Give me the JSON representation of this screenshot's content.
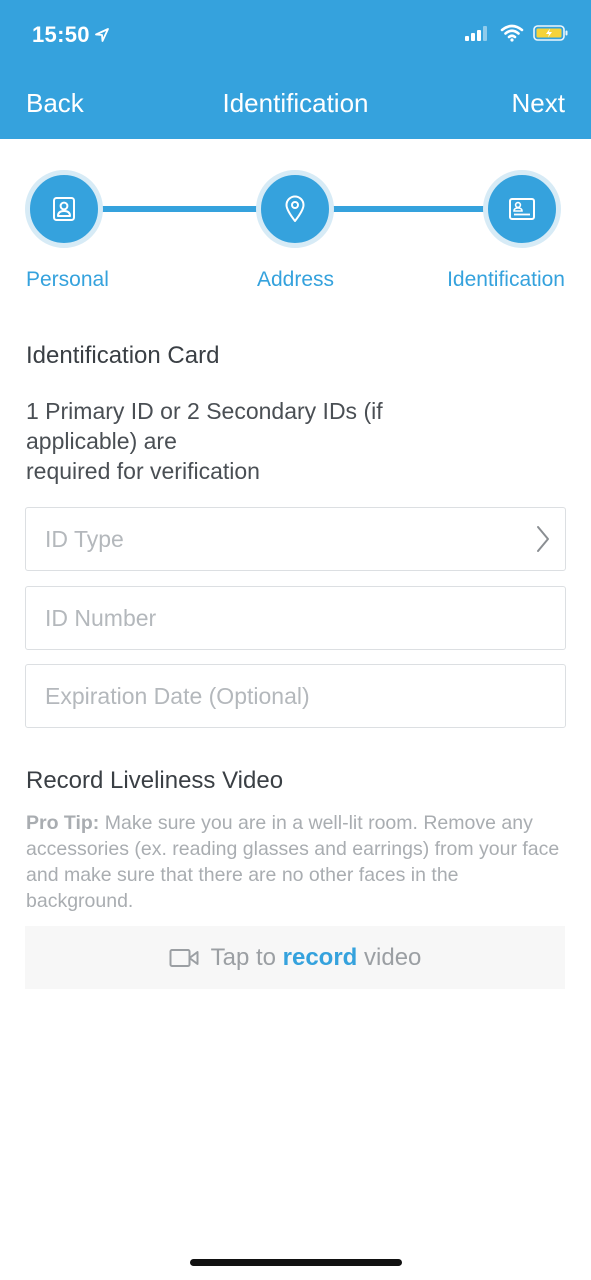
{
  "status_bar": {
    "time": "15:50",
    "icons": [
      "location-arrow-icon",
      "signal-icon",
      "wifi-icon",
      "battery-charging-icon"
    ]
  },
  "nav": {
    "back_label": "Back",
    "title": "Identification",
    "next_label": "Next"
  },
  "stepper": {
    "steps": [
      {
        "label": "Personal",
        "icon": "person-card-icon"
      },
      {
        "label": "Address",
        "icon": "location-pin-icon"
      },
      {
        "label": "Identification",
        "icon": "id-card-icon"
      }
    ]
  },
  "id_section": {
    "title": "Identification Card",
    "description_lines": [
      "1 Primary ID or 2 Secondary IDs (if",
      "applicable) are",
      "required for verification"
    ],
    "fields": [
      {
        "placeholder": "ID Type",
        "icon": "chevron-right-icon"
      },
      {
        "placeholder": "ID Number"
      },
      {
        "placeholder": "Expiration Date (Optional)"
      }
    ]
  },
  "video_section": {
    "title": "Record Liveliness Video",
    "pro_tip_label": "Pro Tip:",
    "pro_tip_text": " Make sure you are in a well-lit room. Remove any accessories (ex. reading glasses and earrings) from your face and make sure that there are no other faces in the background.",
    "record_button": {
      "prefix": "Tap to ",
      "highlight": "record",
      "suffix": " video",
      "icon": "video-camera-icon"
    }
  },
  "colors": {
    "accent": "#35a2dd",
    "battery_fill": "#f5d33a"
  }
}
